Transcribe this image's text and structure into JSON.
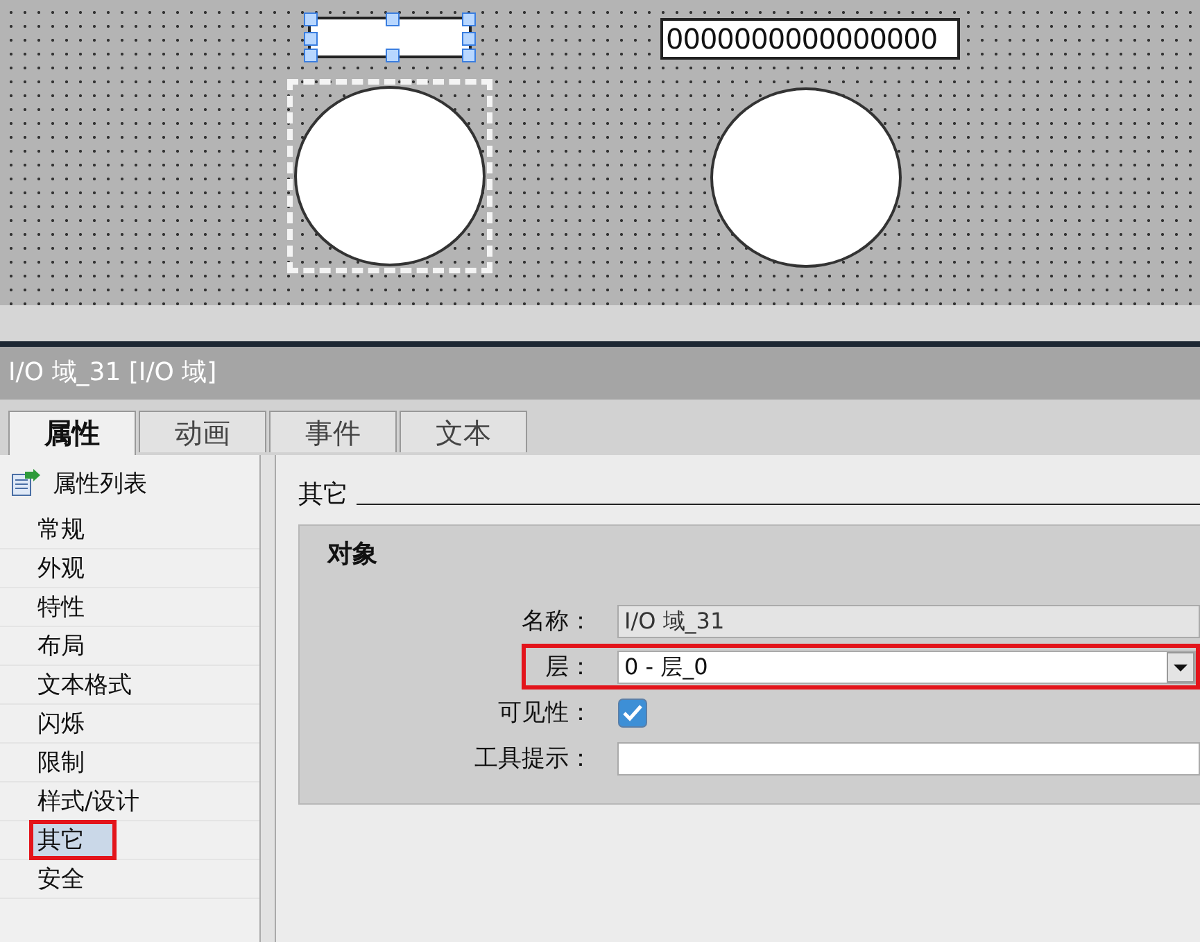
{
  "canvas": {
    "objects": [
      {
        "kind": "io_field",
        "selected": true
      },
      {
        "kind": "circle",
        "selected": true
      },
      {
        "kind": "io_field",
        "value": "0000000000000000",
        "selected": false
      },
      {
        "kind": "circle",
        "selected": false
      }
    ]
  },
  "inspector": {
    "title": "I/O 域_31 [I/O 域]",
    "tabs": [
      {
        "label": "属性",
        "selected": true
      },
      {
        "label": "动画",
        "selected": false
      },
      {
        "label": "事件",
        "selected": false
      },
      {
        "label": "文本",
        "selected": false
      }
    ],
    "sidebar": {
      "header": "属性列表",
      "items": [
        {
          "label": "常规",
          "selected": false,
          "highlighted": false
        },
        {
          "label": "外观",
          "selected": false,
          "highlighted": false
        },
        {
          "label": "特性",
          "selected": false,
          "highlighted": false
        },
        {
          "label": "布局",
          "selected": false,
          "highlighted": false
        },
        {
          "label": "文本格式",
          "selected": false,
          "highlighted": false
        },
        {
          "label": "闪烁",
          "selected": false,
          "highlighted": false
        },
        {
          "label": "限制",
          "selected": false,
          "highlighted": false
        },
        {
          "label": "样式/设计",
          "selected": false,
          "highlighted": false
        },
        {
          "label": "其它",
          "selected": true,
          "highlighted": true
        },
        {
          "label": "安全",
          "selected": false,
          "highlighted": false
        }
      ]
    },
    "section": {
      "title": "其它",
      "group": "对象",
      "properties": [
        {
          "kind": "text",
          "label": "名称：",
          "value": "I/O 域_31",
          "disabled": true,
          "highlighted": false
        },
        {
          "kind": "dropdown",
          "label": "层：",
          "value": "0 - 层_0",
          "highlighted": true
        },
        {
          "kind": "checkbox",
          "label": "可见性：",
          "checked": true,
          "highlighted": false
        },
        {
          "kind": "text",
          "label": "工具提示：",
          "disabled": false,
          "highlighted": false
        }
      ]
    }
  }
}
